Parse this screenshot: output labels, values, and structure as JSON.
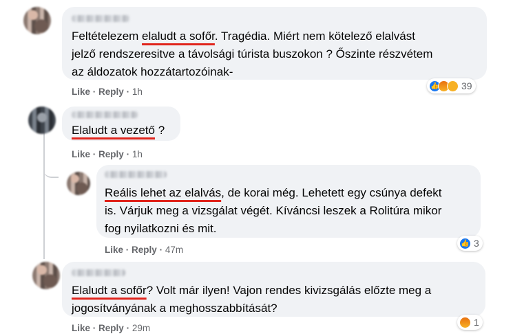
{
  "comments": [
    {
      "text_before": "Feltételezem ",
      "text_underlined": "elaludt a sofőr",
      "text_after": ". Tragédia. Miért nem kötelező elalvást\njelző rendszeresitve a távolsági túrista buszokon ? Őszinte részvétem\naz áldozatok hozzátartozóinak-",
      "like_label": "Like",
      "reply_label": "Reply",
      "time": "1h",
      "reactions": [
        "like",
        "angry",
        "sad"
      ],
      "reaction_count": "39"
    },
    {
      "text_before": "",
      "text_underlined": "Elaludt a vezető",
      "text_after": " ?",
      "like_label": "Like",
      "reply_label": "Reply",
      "time": "1h"
    },
    {
      "text_before": "",
      "text_underlined": "Reális lehet az elalvás",
      "text_after": ", de korai még. Lehetett egy csúnya defekt\nis. Várjuk meg a vizsgálat végét. Kíváncsi leszek a Rolitúra mikor\nfog nyilatkozni és mit.",
      "like_label": "Like",
      "reply_label": "Reply",
      "time": "47m",
      "reactions": [
        "like"
      ],
      "reaction_count": "3"
    },
    {
      "text_before": "",
      "text_underlined": "Elaludt a sofőr",
      "text_after": "? Volt már ilyen! Vajon rendes kivizsgálás előzte meg a\njogosítványának a meghosszabbítását?",
      "like_label": "Like",
      "reply_label": "Reply",
      "time": "29m",
      "reactions": [
        "angry"
      ],
      "reaction_count": "1"
    }
  ],
  "separator": "·",
  "colors": {
    "bubble": "#f0f2f5",
    "underline": "#e0231b",
    "meta": "#65676b",
    "like_blue": "#1877f2"
  }
}
